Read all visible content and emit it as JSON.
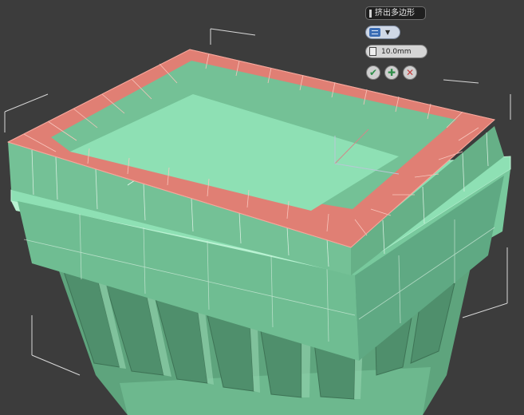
{
  "caddy": {
    "title": "挤出多边形",
    "height_value": "10.0mm",
    "mode_icon": "group-icon",
    "ok_icon": "checkmark-icon",
    "apply_icon": "plus-icon",
    "cancel_icon": "close-icon"
  },
  "colors": {
    "background": "#3c3c3c",
    "mesh_face": "#6db88e",
    "mesh_light": "#8fe0b5",
    "selection": "#e07f74",
    "wire": "#d6efe0"
  }
}
